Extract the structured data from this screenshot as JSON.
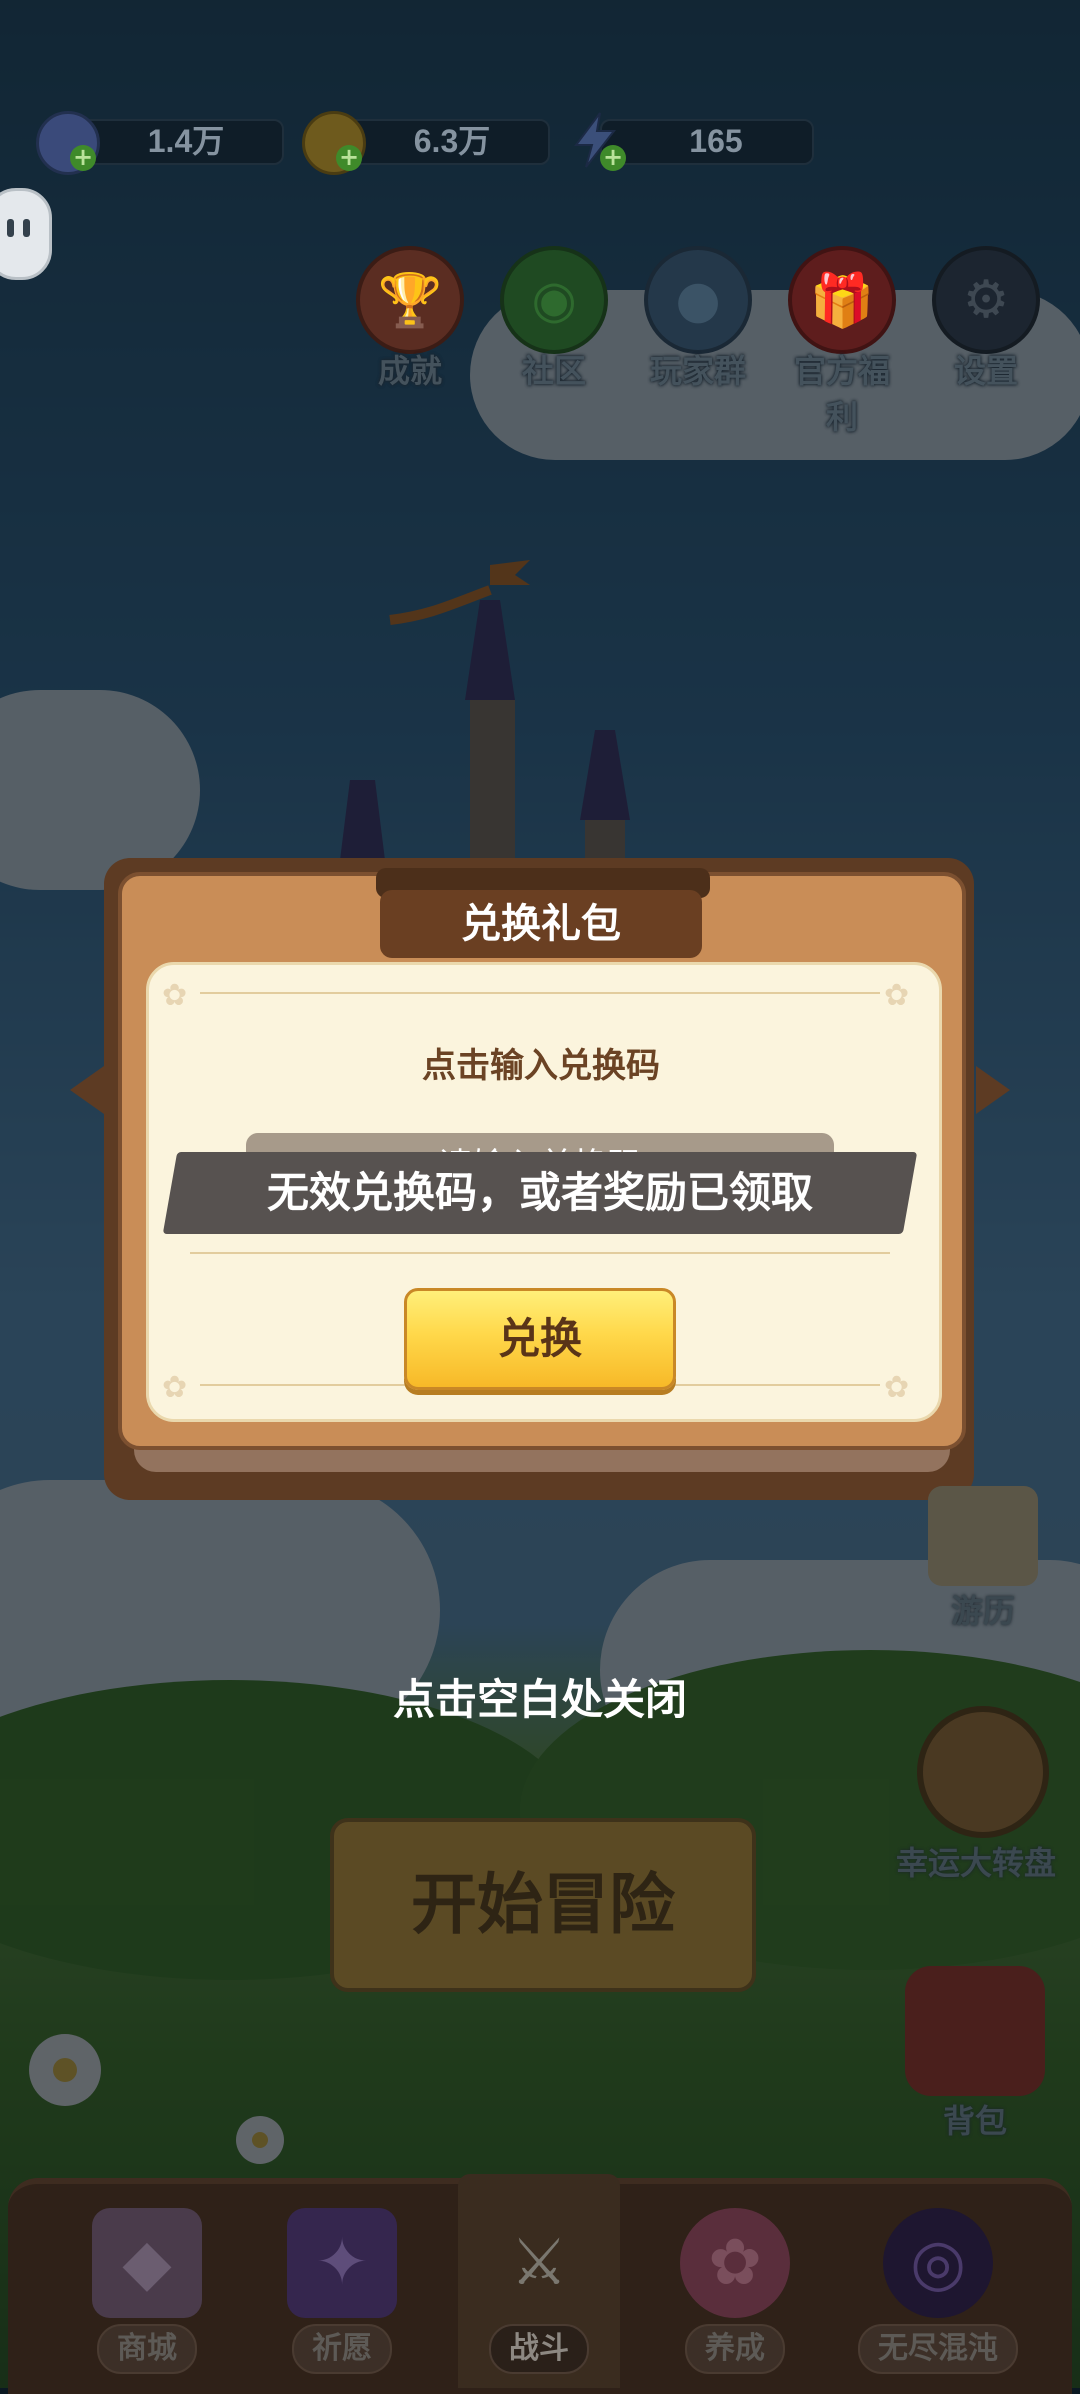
{
  "resources": [
    {
      "icon": "gem-icon",
      "value": "1.4万"
    },
    {
      "icon": "coin-icon",
      "value": "6.3万"
    },
    {
      "icon": "energy-icon",
      "value": "165"
    }
  ],
  "top_icons": [
    {
      "label": "成就",
      "icon": "trophy-icon"
    },
    {
      "label": "社区",
      "icon": "chat-icon"
    },
    {
      "label": "玩家群",
      "icon": "penguin-icon"
    },
    {
      "label": "官方福利",
      "icon": "gift-icon"
    },
    {
      "label": "设置",
      "icon": "gear-icon"
    }
  ],
  "dialog": {
    "title": "兑换礼包",
    "prompt": "点击输入兑换码",
    "input_placeholder": "请输入兑换码",
    "redeem_button": "兑换",
    "toast": "无效兑换码，或者奖励已领取"
  },
  "close_hint": "点击空白处关闭",
  "start_button": "开始冒险",
  "side_buttons": [
    {
      "label": "游历",
      "icon": "map-icon"
    },
    {
      "label": "幸运大转盘",
      "icon": "wheel-icon"
    },
    {
      "label": "背包",
      "icon": "backpack-icon"
    }
  ],
  "nav": [
    {
      "label": "商城",
      "icon": "shop-icon"
    },
    {
      "label": "祈愿",
      "icon": "card-icon"
    },
    {
      "label": "战斗",
      "icon": "swords-icon",
      "active": true
    },
    {
      "label": "养成",
      "icon": "paw-icon"
    },
    {
      "label": "无尽混沌",
      "icon": "vortex-icon"
    }
  ],
  "colors": {
    "dialog_frame": "#c98d57",
    "dialog_paper": "#fbf4dd",
    "redeem_button": "#ffd84a",
    "toast_bg": "#575250"
  }
}
